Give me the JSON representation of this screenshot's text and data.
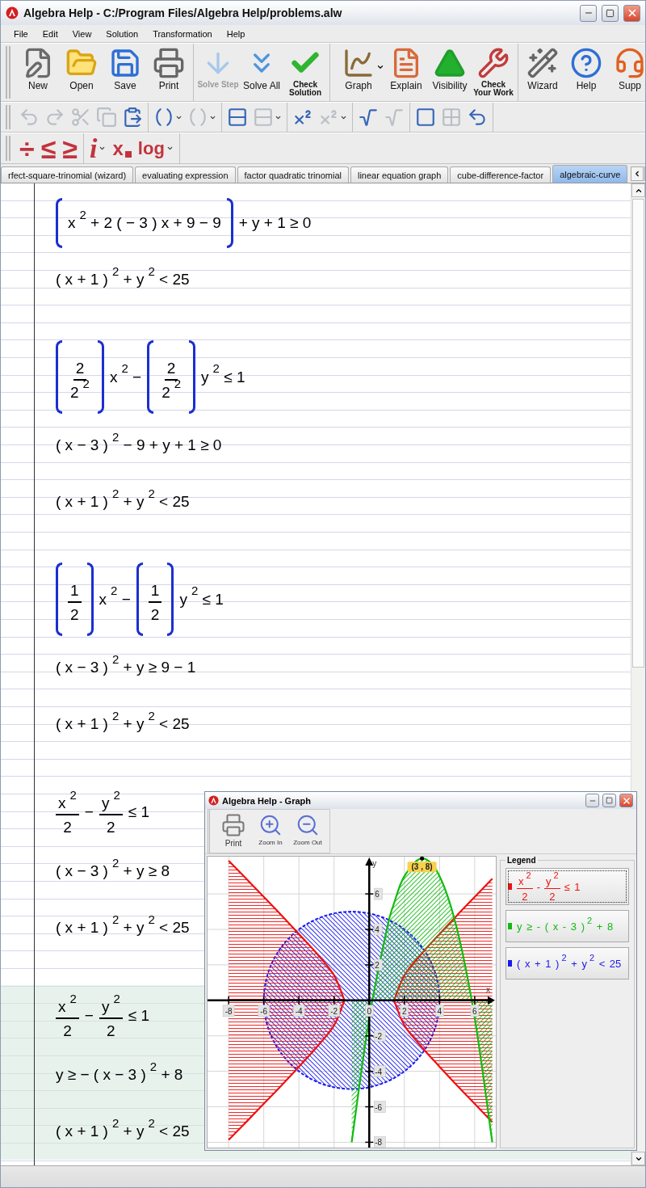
{
  "window": {
    "title": "Algebra Help - C:/Program Files/Algebra Help/problems.alw"
  },
  "menu": [
    "File",
    "Edit",
    "View",
    "Solution",
    "Transformation",
    "Help"
  ],
  "toolbar": {
    "groups": [
      [
        {
          "label": "New",
          "kind": "regular",
          "disabled": false,
          "dropdown": false
        },
        {
          "label": "Open",
          "kind": "regular",
          "disabled": false,
          "dropdown": false
        },
        {
          "label": "Save",
          "kind": "regular",
          "disabled": false,
          "dropdown": false
        },
        {
          "label": "Print",
          "kind": "regular",
          "disabled": false,
          "dropdown": false
        }
      ],
      [
        {
          "label": "Solve Step",
          "kind": "compact",
          "disabled": true,
          "dropdown": false
        },
        {
          "label": "Solve All",
          "kind": "regular",
          "disabled": false,
          "dropdown": false
        },
        {
          "label": "Check Solution",
          "kind": "compact",
          "disabled": false,
          "dropdown": false
        }
      ],
      [
        {
          "label": "Graph",
          "kind": "regular",
          "disabled": false,
          "dropdown": true
        },
        {
          "label": "Explain",
          "kind": "regular",
          "disabled": false,
          "dropdown": false
        },
        {
          "label": "Visibility",
          "kind": "regular",
          "disabled": false,
          "dropdown": false
        },
        {
          "label": "Check Your Work",
          "kind": "compact",
          "disabled": false,
          "dropdown": false
        }
      ],
      [
        {
          "label": "Wizard",
          "kind": "regular",
          "disabled": false,
          "dropdown": false
        },
        {
          "label": "Help",
          "kind": "regular",
          "disabled": false,
          "dropdown": false
        },
        {
          "label": "Supp",
          "kind": "regular",
          "disabled": false,
          "dropdown": false
        }
      ]
    ]
  },
  "format_toolbar": {
    "groups": [
      [
        {
          "disabled": true,
          "dropdown": false
        },
        {
          "disabled": true,
          "dropdown": false
        },
        {
          "disabled": true,
          "dropdown": false
        },
        {
          "disabled": true,
          "dropdown": false
        },
        {
          "disabled": false,
          "dropdown": false
        }
      ],
      [
        {
          "disabled": false,
          "dropdown": true
        },
        {
          "disabled": true,
          "dropdown": true
        }
      ],
      [
        {
          "disabled": false,
          "dropdown": false
        },
        {
          "disabled": true,
          "dropdown": true
        }
      ],
      [
        {
          "disabled": false,
          "dropdown": false
        },
        {
          "disabled": true,
          "dropdown": true
        }
      ],
      [
        {
          "disabled": false,
          "dropdown": false
        },
        {
          "disabled": true,
          "dropdown": false
        }
      ],
      [
        {
          "disabled": false,
          "dropdown": false
        },
        {
          "disabled": true,
          "dropdown": false
        },
        {
          "disabled": false,
          "dropdown": false
        }
      ]
    ]
  },
  "symbol_toolbar": {
    "groups": [
      [
        {
          "glyph": "÷",
          "kind": "operator",
          "dropdown": false
        },
        {
          "glyph": "≤",
          "kind": "operator",
          "dropdown": false
        },
        {
          "glyph": "≥",
          "kind": "operator",
          "dropdown": false
        }
      ],
      [
        {
          "glyph": "i",
          "kind": "italic",
          "dropdown": true
        },
        {
          "glyph": "x",
          "kind": "subscript",
          "dropdown": false
        },
        {
          "glyph": "log",
          "kind": "word",
          "dropdown": true
        }
      ]
    ]
  },
  "tabs": [
    {
      "label": "rfect-square-trinomial (wizard)",
      "selected": false
    },
    {
      "label": "evaluating expression",
      "selected": false
    },
    {
      "label": "factor quadratic trinomial",
      "selected": false
    },
    {
      "label": "linear equation graph",
      "selected": false
    },
    {
      "label": "cube-difference-factor",
      "selected": false
    },
    {
      "label": "algebraic-curve",
      "selected": true
    }
  ],
  "document": {
    "blocks": [
      {
        "selected": false,
        "lines": [
          [
            {
              "kind": "bracket",
              "parts": [
                {
                  "kind": "text",
                  "text": "x$^{2}$ + 2 ( − 3 ) x + 9 − 9"
                }
              ]
            },
            {
              "kind": "text",
              "text": "+ y + 1 ≥ 0"
            }
          ],
          [
            {
              "kind": "text",
              "text": "( x + 1 )$^{2}$ + y$^{2}$ < 25"
            }
          ]
        ]
      },
      {
        "selected": false,
        "lines": [
          [
            {
              "kind": "bracket",
              "parts": [
                {
                  "kind": "fraction",
                  "numerator": "2",
                  "denominator": "2$^{2}$"
                }
              ]
            },
            {
              "kind": "text",
              "text": "x$^{2}$ −"
            },
            {
              "kind": "bracket",
              "parts": [
                {
                  "kind": "fraction",
                  "numerator": "2",
                  "denominator": "2$^{2}$"
                }
              ]
            },
            {
              "kind": "text",
              "text": "y$^{2}$ ≤ 1"
            }
          ],
          [
            {
              "kind": "text",
              "text": "( x − 3 )$^{2}$ − 9 + y + 1 ≥ 0"
            }
          ],
          [
            {
              "kind": "text",
              "text": "( x + 1 )$^{2}$ + y$^{2}$ < 25"
            }
          ]
        ]
      },
      {
        "selected": false,
        "lines": [
          [
            {
              "kind": "bracket",
              "parts": [
                {
                  "kind": "fraction",
                  "numerator": "1",
                  "denominator": "2"
                }
              ]
            },
            {
              "kind": "text",
              "text": "x$^{2}$ −"
            },
            {
              "kind": "bracket",
              "parts": [
                {
                  "kind": "fraction",
                  "numerator": "1",
                  "denominator": "2"
                }
              ]
            },
            {
              "kind": "text",
              "text": "y$^{2}$ ≤ 1"
            }
          ],
          [
            {
              "kind": "text",
              "text": "( x − 3 )$^{2}$ + y ≥ 9 − 1"
            }
          ],
          [
            {
              "kind": "text",
              "text": "( x + 1 )$^{2}$ + y$^{2}$ < 25"
            }
          ]
        ]
      },
      {
        "selected": false,
        "lines": [
          [
            {
              "kind": "fraction",
              "numerator": "x$^{2}$",
              "denominator": "2"
            },
            {
              "kind": "text",
              "text": "−"
            },
            {
              "kind": "fraction",
              "numerator": "y$^{2}$",
              "denominator": "2"
            },
            {
              "kind": "text",
              "text": "≤ 1"
            }
          ],
          [
            {
              "kind": "text",
              "text": "( x − 3 )$^{2}$ + y ≥ 8"
            }
          ],
          [
            {
              "kind": "text",
              "text": "( x + 1 )$^{2}$ + y$^{2}$ < 25"
            }
          ]
        ]
      },
      {
        "selected": true,
        "lines": [
          [
            {
              "kind": "fraction",
              "numerator": "x$^{2}$",
              "denominator": "2"
            },
            {
              "kind": "text",
              "text": "−"
            },
            {
              "kind": "fraction",
              "numerator": "y$^{2}$",
              "denominator": "2"
            },
            {
              "kind": "text",
              "text": "≤ 1"
            }
          ],
          [
            {
              "kind": "text",
              "text": "y ≥ − ( x − 3 )$^{2}$ + 8"
            }
          ],
          [
            {
              "kind": "text",
              "text": "( x + 1 )$^{2}$ + y$^{2}$ < 25"
            }
          ]
        ]
      }
    ]
  },
  "graph_window": {
    "title": "Algebra Help - Graph",
    "toolbar": [
      {
        "label": "Print"
      },
      {
        "label": "Zoom In"
      },
      {
        "label": "Zoom Out"
      }
    ],
    "chart_data": {
      "type": "area",
      "xlabel": "x",
      "ylabel": "y",
      "xlim": [
        -9.2,
        7.2
      ],
      "ylim": [
        -8.3,
        8.1
      ],
      "grid": true,
      "xticks": [
        -8,
        -6,
        -4,
        -2,
        0,
        2,
        4,
        6
      ],
      "yticks": [
        -8,
        -6,
        -4,
        -2,
        2,
        4,
        6
      ],
      "x": [
        -8,
        -7,
        -6,
        -5,
        -4,
        -3,
        -2,
        -1.41,
        -1,
        0,
        1,
        1.41,
        2,
        3,
        4,
        5,
        6,
        7
      ],
      "series": [
        {
          "color": "#ee1111",
          "line_style": "solid",
          "values": [
            7.87,
            6.86,
            5.83,
            4.8,
            3.74,
            2.65,
            1.41,
            0,
            null,
            null,
            null,
            0,
            1.41,
            2.65,
            3.74,
            4.8,
            5.83,
            6.86
          ]
        },
        {
          "color": "#ee1111",
          "line_style": "solid",
          "values": [
            -7.87,
            -6.86,
            -5.83,
            -4.8,
            -3.74,
            -2.65,
            -1.41,
            0,
            null,
            null,
            null,
            0,
            -1.41,
            -2.65,
            -3.74,
            -4.8,
            -5.83,
            -6.86
          ]
        },
        {
          "color": "#11bb11",
          "line_style": "solid",
          "values": [
            null,
            null,
            null,
            null,
            null,
            null,
            null,
            null,
            -8,
            -1,
            4,
            5.47,
            7,
            8,
            7,
            4,
            -1,
            -8
          ]
        }
      ],
      "annotations": [
        {
          "x": 3,
          "y": 8,
          "text": "(3 , 8)"
        }
      ]
    },
    "legend": {
      "title": "Legend",
      "items": [
        {
          "color": "#ee1111",
          "selected": true,
          "parts": [
            {
              "kind": "fraction",
              "numerator": "x$^{2}$",
              "denominator": "2"
            },
            {
              "kind": "text",
              "text": "-"
            },
            {
              "kind": "fraction",
              "numerator": "y$^{2}$",
              "denominator": "2"
            },
            {
              "kind": "text",
              "text": "≤ 1"
            }
          ]
        },
        {
          "color": "#11bb11",
          "selected": false,
          "parts": [
            {
              "kind": "text",
              "text": "y ≥ - ( x - 3 )$^{2}$ + 8"
            }
          ]
        },
        {
          "color": "#1a1aee",
          "selected": false,
          "parts": [
            {
              "kind": "text",
              "text": "( x + 1 )$^{2}$ + y$^{2}$ < 25"
            }
          ]
        }
      ]
    }
  }
}
